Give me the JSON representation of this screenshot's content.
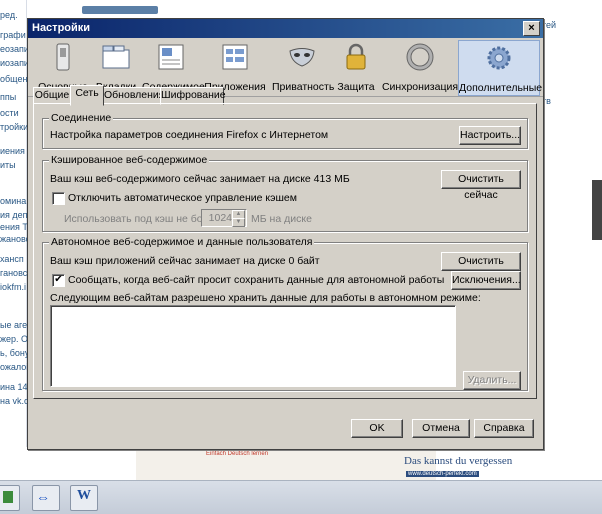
{
  "background": {
    "left_fragments": [
      "ред.",
      "графи",
      "еозапи",
      "иозапи",
      "общени",
      "ппы",
      "ости",
      "тройки",
      "иения",
      "иты",
      "омина",
      "ия деп",
      "ения Т",
      "жановс",
      "хансп",
      "гановс",
      "iokfm.i",
      "ые агеi",
      "жер. О",
      "ь, бону",
      "ожалоi",
      "ина 14 ,",
      "на vk.com"
    ],
    "right_fragments": [
      "тей",
      "тв"
    ],
    "banner_text": "Das kannst du vergessen",
    "banner_url": "www.deutsch-perfekt.com",
    "banner_small": "Einfach Deutsch lernen"
  },
  "dialog": {
    "title": "Настройки",
    "close": "×",
    "panes": [
      {
        "label": "Основные",
        "icon": "switch-icon"
      },
      {
        "label": "Вкладки",
        "icon": "tabs-icon"
      },
      {
        "label": "Содержимое",
        "icon": "content-icon"
      },
      {
        "label": "Приложения",
        "icon": "applications-icon"
      },
      {
        "label": "Приватность",
        "icon": "mask-icon"
      },
      {
        "label": "Защита",
        "icon": "lock-icon"
      },
      {
        "label": "Синхронизация",
        "icon": "sync-icon"
      },
      {
        "label": "Дополнительные",
        "icon": "gear-icon",
        "selected": true
      }
    ],
    "tabs": [
      {
        "label": "Общие"
      },
      {
        "label": "Сеть",
        "selected": true
      },
      {
        "label": "Обновления"
      },
      {
        "label": "Шифрование"
      }
    ],
    "connection": {
      "title": "Соединение",
      "desc": "Настройка параметров соединения Firefox с Интернетом",
      "button": "Настроить..."
    },
    "cache": {
      "title": "Кэшированное веб-содержимое",
      "usage": "Ваш кэш веб-содержимого сейчас занимает на диске 413 МБ",
      "clear_button": "Очистить сейчас",
      "override_label": "Отключить автоматическое управление кэшем",
      "override_checked": false,
      "limit_label": "Использовать под кэш не более",
      "limit_value": "1024",
      "limit_unit": "МБ на диске"
    },
    "offline": {
      "title": "Автономное веб-содержимое и данные пользователя",
      "usage": "Ваш кэш приложений сейчас занимает на диске 0 байт",
      "clear_button": "Очистить сейчас",
      "notify_label": "Сообщать, когда веб-сайт просит сохранить данные для автономной работы",
      "notify_checked": true,
      "exceptions_button": "Исключения...",
      "allowed_label": "Следующим веб-сайтам разрешено хранить данные для работы в автономном режиме:",
      "remove_button": "Удалить..."
    },
    "footer": {
      "ok": "OK",
      "cancel": "Отмена",
      "help": "Справка"
    }
  }
}
